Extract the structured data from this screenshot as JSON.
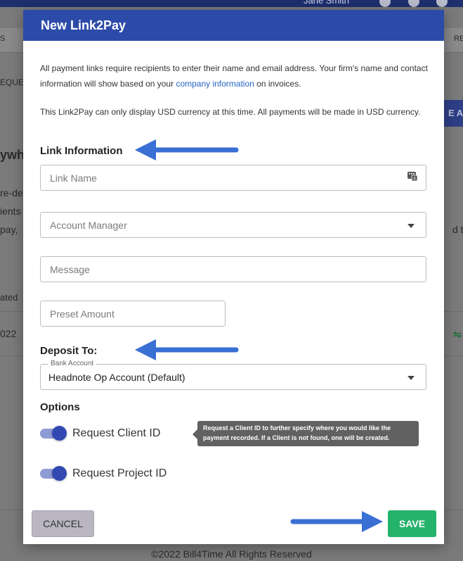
{
  "background": {
    "user_name": "Jane Smith",
    "nav_left": "S",
    "nav_right": "RE",
    "side_texts": [
      "EQUE",
      "ywh",
      "re-de",
      "ients",
      "pay,",
      "ated",
      "022"
    ],
    "right_text": "d th",
    "right_button": "E A",
    "footer": "©2022 Bill4Time All Rights Reserved"
  },
  "modal": {
    "title": "New Link2Pay",
    "intro_1_before": "All payment links require recipients to enter their name and email address. Your firm's name and contact information will show based on your ",
    "intro_1_link": "company information",
    "intro_1_after": " on invoices.",
    "intro_2": "This Link2Pay can only display USD currency at this time. All payments will be made in USD currency.",
    "link_info_title": "Link Information",
    "link_name_placeholder": "Link Name",
    "account_manager_placeholder": "Account Manager",
    "message_placeholder": "Message",
    "preset_amount_placeholder": "Preset Amount",
    "deposit_title": "Deposit To:",
    "bank_account_label": "Bank Account",
    "bank_account_value": "Headnote Op Account (Default)",
    "options_title": "Options",
    "request_client_id_label": "Request Client ID",
    "request_project_id_label": "Request Project ID",
    "tooltip": "Request a Client ID to further specify where you would like the payment recorded. If a Client is not found, one will be created.",
    "cancel_label": "CANCEL",
    "save_label": "SAVE"
  },
  "toggles": {
    "request_client_id": true,
    "request_project_id": true
  },
  "colors": {
    "header": "#2c4ba8",
    "save": "#25b26b",
    "arrow": "#3a6fd4",
    "link": "#2466c3"
  }
}
